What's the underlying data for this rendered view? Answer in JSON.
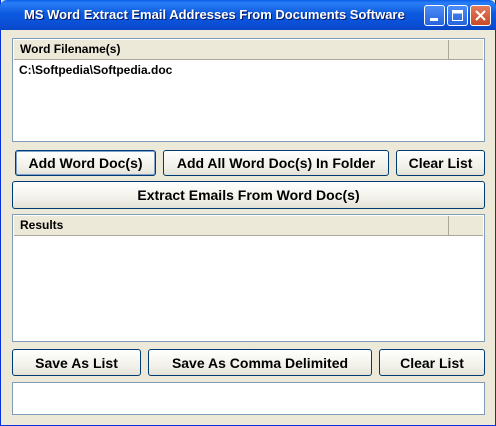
{
  "window": {
    "title": "MS Word Extract Email Addresses From Documents Software"
  },
  "files": {
    "column_header": "Word Filename(s)",
    "items": [
      "C:\\Softpedia\\Softpedia.doc"
    ]
  },
  "buttons_top": {
    "add_doc": "Add Word Doc(s)",
    "add_folder": "Add All Word Doc(s) In Folder",
    "clear": "Clear List"
  },
  "extract_button": "Extract Emails From Word Doc(s)",
  "results": {
    "column_header": "Results"
  },
  "buttons_bottom": {
    "save_list": "Save As List",
    "save_comma": "Save As Comma Delimited",
    "clear": "Clear List"
  },
  "colors": {
    "titlebar": "#0a5fe8",
    "face": "#ece9d8",
    "border": "#7f9db9"
  }
}
